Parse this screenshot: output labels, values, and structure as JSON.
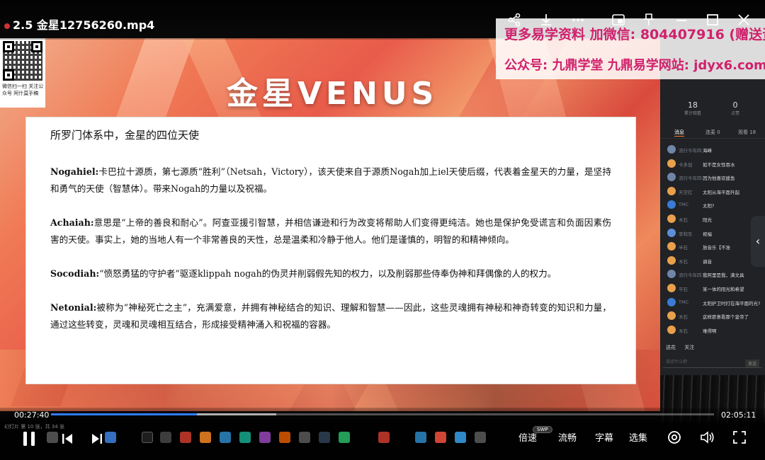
{
  "window": {
    "title": "2.5 金星12756260.mp4",
    "share_icon": "share-icon",
    "download_icon": "download-icon",
    "more_icon": "more-icon",
    "pip_icon": "pip-icon",
    "pin_icon": "pin-icon",
    "minimize_icon": "minimize-icon",
    "maximize_icon": "maximize-icon",
    "close_icon": "close-icon"
  },
  "watermark": {
    "line1": "更多易学资料 加微信: 804407916 (赠送资料)",
    "line2": "公众号: 九鼎学堂 九鼎易学网站: jdyx6.com"
  },
  "slide": {
    "heading": "金星VENUS",
    "qr_caption": "微信扫一扫 关注公众号 阿什莫手稿",
    "card_title": "所罗门体系中，金星的四位天使",
    "paragraphs": [
      {
        "name": "Nogahiel:",
        "text": "卡巴拉十源质，第七源质“胜利”（Netsah，Victory），该天使来自于源质Nogah加上iel天使后缀，代表着金星天的力量，是坚持和勇气的天使（智慧体）。带来Nogah的力量以及祝福。"
      },
      {
        "name": "Achaiah:",
        "text": "意思是“上帝的善良和耐心”。阿查亚援引智慧，并相信谦逊和行为改变将帮助人们变得更纯洁。她也是保护免受谎言和负面因素伤害的天使。事实上，她的当地人有一个非常善良的天性，总是温柔和冷静于他人。他们是谨慎的，明智的和精神倾向。"
      },
      {
        "name": "Socodiah:",
        "text": "“愤怒勇猛的守护者”驱逐klippah nogah的伪灵并削弱假先知的权力，以及削弱那些侍奉伪神和拜偶像的人的权力。"
      },
      {
        "name": "Netonial:",
        "text": "被称为“神秘死亡之主”，充满爱意，并拥有神秘结合的知识、理解和智慧——因此，这些灵魂拥有神秘和神奇转变的知识和力量，通过这些转变，灵魂和灵魂相互结合，形成接受精神涌入和祝福的容器。"
      }
    ]
  },
  "side_panel": {
    "stats": [
      {
        "value": "18",
        "label": "累计观看"
      },
      {
        "value": "0",
        "label": "点赞"
      }
    ],
    "tabs": [
      "消息",
      "连麦 0",
      "观看 18"
    ],
    "messages": [
      {
        "name": "流行今年四",
        "text": "海峰",
        "color": "#6f86a8"
      },
      {
        "name": "卡多加",
        "text": "如不是女性吞水",
        "color": "#e8a04c"
      },
      {
        "name": "流行今年四",
        "text": "因为他喜欢援鱼",
        "color": "#6f86a8"
      },
      {
        "name": "天空红",
        "text": "太阳从海平面升起",
        "color": "#e8a04c"
      },
      {
        "name": "TMC",
        "text": "太阳?",
        "color": "#3a7bd5"
      },
      {
        "name": "木石",
        "text": "阳光",
        "color": "#e8a04c"
      },
      {
        "name": "李和东",
        "text": "祝福",
        "color": "#5b8fd6"
      },
      {
        "name": "半石",
        "text": "放音乐【不准",
        "color": "#e8a04c"
      },
      {
        "name": "木石",
        "text": "调音",
        "color": "#e8a04c"
      },
      {
        "name": "流行今年四",
        "text": "我阿里是我，满文具",
        "color": "#6f86a8"
      },
      {
        "name": "平石",
        "text": "某一体的阳光和希望",
        "color": "#e8a04c"
      },
      {
        "name": "TMC",
        "text": "太阳护卫时打在海平面的光?",
        "color": "#3a7bd5"
      },
      {
        "name": "木石",
        "text": "这样愿意看那个皇帝了",
        "color": "#e8a04c"
      },
      {
        "name": "木石",
        "text": "难得啊",
        "color": "#e8a04c"
      }
    ],
    "gifts": [
      "送花",
      "关注"
    ],
    "input_placeholder": "说点什么吧",
    "send_label": "发送"
  },
  "player": {
    "current_time": "00:27:40",
    "total_time": "02:05:11",
    "progress_fraction": 0.22,
    "buffered_fraction": 0.34,
    "taskbar_text": "幻灯片 第 10 张，共 34 张",
    "swp_label": "SWP",
    "speed_label": "倍速",
    "quality_label": "流畅",
    "subtitle_label": "字幕",
    "episodes_label": "选集"
  }
}
